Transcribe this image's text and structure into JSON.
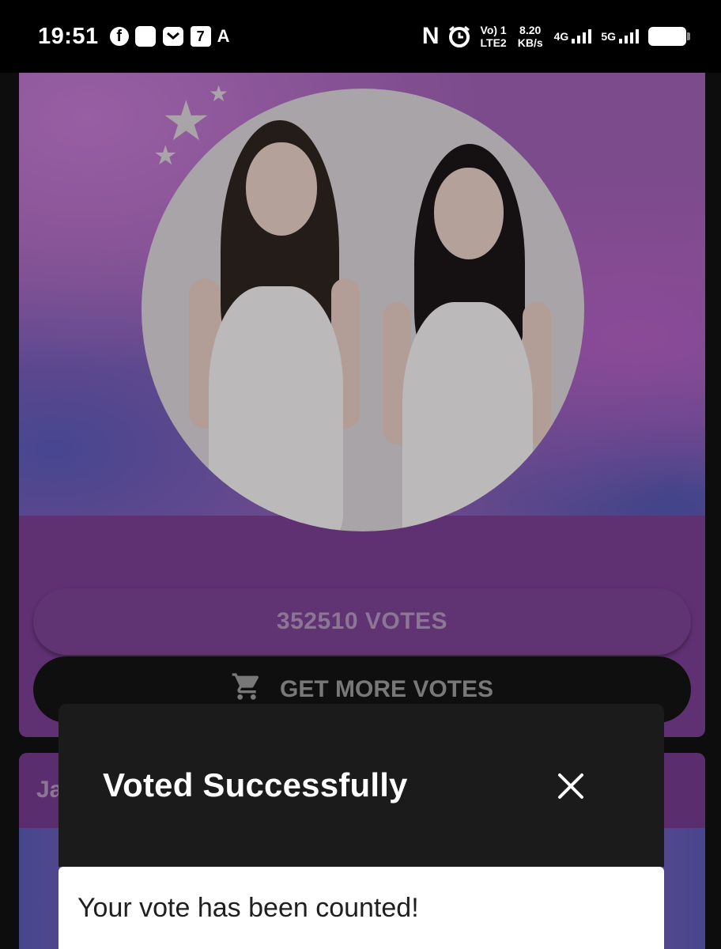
{
  "status_bar": {
    "time": "19:51",
    "icons": [
      "facebook-icon",
      "square-notification-icon",
      "mail-icon",
      "seven-eleven-icon"
    ],
    "letter": "A",
    "network_letter": "N",
    "volte_top": "Vo) 1",
    "volte_bottom": "LTE2",
    "speed_value": "8.20",
    "speed_unit": "KB/s",
    "signal_1_label": "4G",
    "signal_2_label": "5G"
  },
  "card": {
    "votes_label": "352510 VOTES",
    "get_more_label": "GET MORE VOTES",
    "cart_icon": "cart-icon"
  },
  "card2": {
    "title_partial": "Ja"
  },
  "dialog": {
    "title": "Voted Successfully",
    "message": "Your vote has been counted!",
    "close_icon": "close-icon"
  },
  "colors": {
    "card_purple": "#7a3f93",
    "dialog_dark": "#1b1b1b",
    "button_dark": "#141414"
  }
}
